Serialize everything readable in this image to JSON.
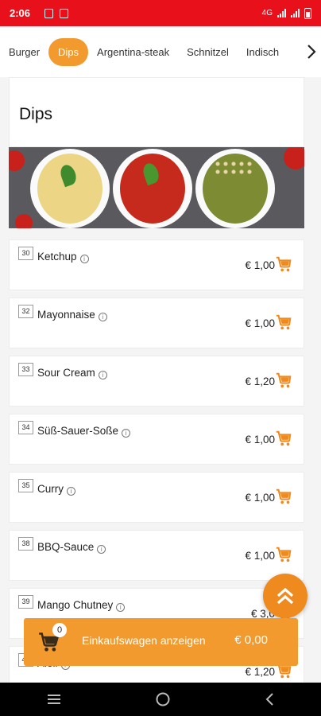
{
  "status_bar": {
    "time": "2:06",
    "network": "4G"
  },
  "tabs": [
    {
      "label": "Burger",
      "active": false
    },
    {
      "label": "Dips",
      "active": true
    },
    {
      "label": "Argentina-steak",
      "active": false
    },
    {
      "label": "Schnitzel",
      "active": false
    },
    {
      "label": "Indisch",
      "active": false
    }
  ],
  "category": {
    "title": "Dips"
  },
  "items": [
    {
      "number": "30",
      "name": "Ketchup",
      "price": "€ 1,00"
    },
    {
      "number": "32",
      "name": "Mayonnaise",
      "price": "€ 1,00"
    },
    {
      "number": "33",
      "name": "Sour Cream",
      "price": "€ 1,20"
    },
    {
      "number": "34",
      "name": "Süß-Sauer-Soße",
      "price": "€ 1,00"
    },
    {
      "number": "35",
      "name": "Curry",
      "price": "€ 1,00"
    },
    {
      "number": "38",
      "name": "BBQ-Sauce",
      "price": "€ 1,00"
    },
    {
      "number": "39",
      "name": "Mango Chutney",
      "price": "€ 3,0"
    },
    {
      "number": "42",
      "name": "Aioli",
      "price": "€ 1,20"
    }
  ],
  "cart": {
    "count": "0",
    "label": "Einkaufswagen anzeigen",
    "total": "€ 0,00"
  },
  "colors": {
    "accent": "#f29a2e",
    "status_bar": "#e8101b",
    "cart_icon": "#ef8a1f"
  },
  "icons": {
    "scroll_right": "chevron-right-icon",
    "back_to_top": "double-chevron-up-icon",
    "cart": "cart-icon",
    "info": "info-icon"
  }
}
